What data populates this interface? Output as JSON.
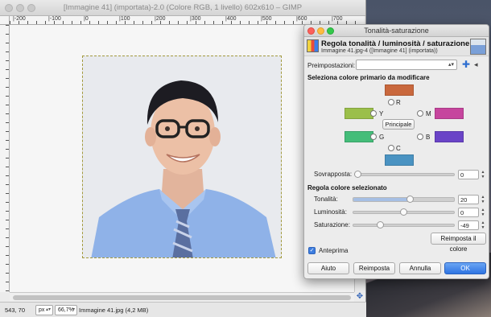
{
  "main_window": {
    "title": "[Immagine 41] (importata)-2.0 (Colore RGB, 1 livello) 602x610 – GIMP",
    "ruler_labels": [
      "|-200",
      "|-100",
      "|0",
      "|100",
      "|200",
      "|300",
      "|400",
      "|500",
      "|600",
      "|700"
    ],
    "status": {
      "coords": "543, 70",
      "unit": "px",
      "zoom": "66,7%",
      "file_info": "Immagine 41.jpg (4,2 MB)"
    }
  },
  "dialog": {
    "title": "Tonalità-saturazione",
    "header_title": "Regola tonalità / luminosità / saturazione",
    "header_subtitle": "Immagine 41.jpg-4 ([Immagine 41] (importata))",
    "presets_label": "Preimpostazioni:",
    "presets_value": "",
    "section_primary": "Seleziona colore primario da modificare",
    "colors": {
      "R": {
        "label": "R",
        "hex": "#c9683d"
      },
      "Y": {
        "label": "Y",
        "hex": "#9bbf4a"
      },
      "G": {
        "label": "G",
        "hex": "#44bd79"
      },
      "C": {
        "label": "C",
        "hex": "#4a93c2"
      },
      "B": {
        "label": "B",
        "hex": "#6a44c7"
      },
      "M": {
        "label": "M",
        "hex": "#c6459e"
      }
    },
    "master_button": "Principale",
    "overlap_label": "Sovrapposta:",
    "overlap_value": "0",
    "section_adjust": "Regola colore selezionato",
    "hue_label": "Tonalità:",
    "hue_value": "20",
    "lightness_label": "Luminosità:",
    "lightness_value": "0",
    "saturation_label": "Saturazione:",
    "saturation_value": "-49",
    "reset_color_button": "Reimposta il colore",
    "preview_label": "Anteprima",
    "buttons": {
      "help": "Aiuto",
      "reset": "Reimposta",
      "cancel": "Annulla",
      "ok": "OK"
    }
  }
}
